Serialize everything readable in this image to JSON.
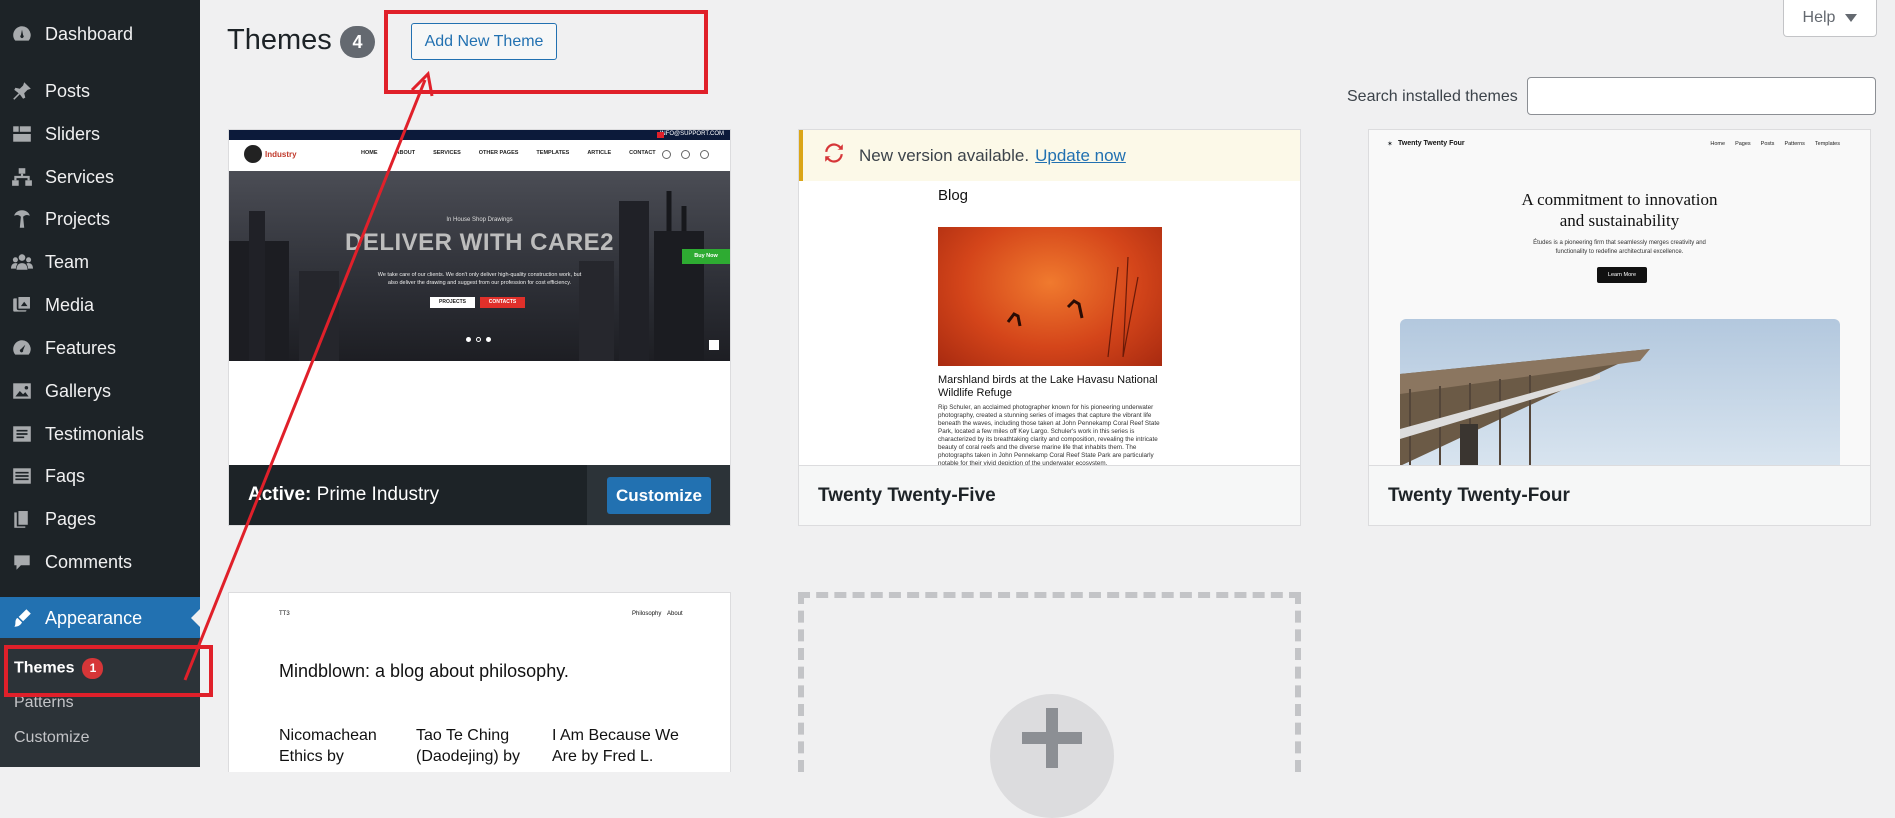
{
  "sidebar": {
    "items": [
      {
        "label": "Dashboard",
        "icon": "dashboard-icon"
      },
      {
        "label": "Posts",
        "icon": "pin-icon"
      },
      {
        "label": "Sliders",
        "icon": "slides-icon"
      },
      {
        "label": "Services",
        "icon": "networking-icon"
      },
      {
        "label": "Projects",
        "icon": "palmtree-icon"
      },
      {
        "label": "Team",
        "icon": "groups-icon"
      },
      {
        "label": "Media",
        "icon": "media-icon"
      },
      {
        "label": "Features",
        "icon": "performance-icon"
      },
      {
        "label": "Gallerys",
        "icon": "gallery-icon"
      },
      {
        "label": "Testimonials",
        "icon": "testimonial-icon"
      },
      {
        "label": "Faqs",
        "icon": "list-icon"
      },
      {
        "label": "Pages",
        "icon": "pages-icon"
      },
      {
        "label": "Comments",
        "icon": "comments-icon"
      },
      {
        "label": "Appearance",
        "icon": "appearance-icon"
      }
    ],
    "submenu": {
      "themes_label": "Themes",
      "themes_badge": "1",
      "patterns_label": "Patterns",
      "customize_label": "Customize"
    }
  },
  "header": {
    "title": "Themes",
    "count": "4",
    "add_new_label": "Add New Theme",
    "help_label": "Help",
    "search_label": "Search installed themes",
    "search_value": ""
  },
  "themes": {
    "prime": {
      "active_prefix": "Active:",
      "name": "Prime Industry",
      "customize_label": "Customize",
      "preview": {
        "top_email": "INFO@SUPPORT.COM",
        "logo_text": "Industry",
        "nav": [
          "HOME",
          "ABOUT",
          "SERVICES",
          "OTHER PAGES",
          "TEMPLATES",
          "ARTICLE",
          "CONTACT"
        ],
        "kicker": "In House Shop Drawings",
        "headline": "DELIVER WITH CARE2",
        "body": "We take care of our clients. We don't only deliver high-quality construction work, but also deliver the drawing and suggest from our profession for cost efficiency.",
        "btn_projects": "PROJECTS",
        "btn_contacts": "CONTACTS",
        "buy_now": "Buy Now"
      }
    },
    "tt5": {
      "name": "Twenty Twenty-Five",
      "notice_text": "New version available.",
      "notice_link": "Update now",
      "preview": {
        "heading": "Blog",
        "caption": "Marshland birds at the Lake Havasu National Wildlife Refuge",
        "body": "Rip Schuler, an acclaimed photographer known for his pioneering underwater photography, created a stunning series of images that capture the vibrant life beneath the waves, including those taken at John Pennekamp Coral Reef State Park, located a few miles off Key Largo. Schuler's work in this series is characterized by its breathtaking clarity and composition, revealing the intricate beauty of coral reefs and the diverse marine life that inhabits them. The photographs taken in John Pennekamp Coral Reef State Park are particularly notable for their vivid depiction of the underwater ecosystem."
      }
    },
    "tt4": {
      "name": "Twenty Twenty-Four",
      "preview": {
        "site_title": "Twenty Twenty Four",
        "nav": [
          "Home",
          "Pages",
          "Posts",
          "Patterns",
          "Templates"
        ],
        "headline_line1": "A commitment to innovation",
        "headline_line2": "and sustainability",
        "sub": "Études is a pioneering firm that seamlessly merges creativity and functionality to redefine architectural excellence.",
        "button": "Learn More"
      }
    },
    "tt3": {
      "preview": {
        "site_title": "TT3",
        "nav": [
          "Philosophy",
          "About"
        ],
        "headline": "Mindblown: a blog about philosophy.",
        "posts": [
          {
            "line1": "Nicomachean",
            "line2": "Ethics by"
          },
          {
            "line1": "Tao Te Ching",
            "line2": "(Daodejing) by"
          },
          {
            "line1": "I Am Because We",
            "line2": "Are by Fred L."
          }
        ]
      }
    }
  },
  "colors": {
    "sidebar_bg": "#1d2327",
    "accent": "#2271b1",
    "annotation": "#e0202a"
  }
}
